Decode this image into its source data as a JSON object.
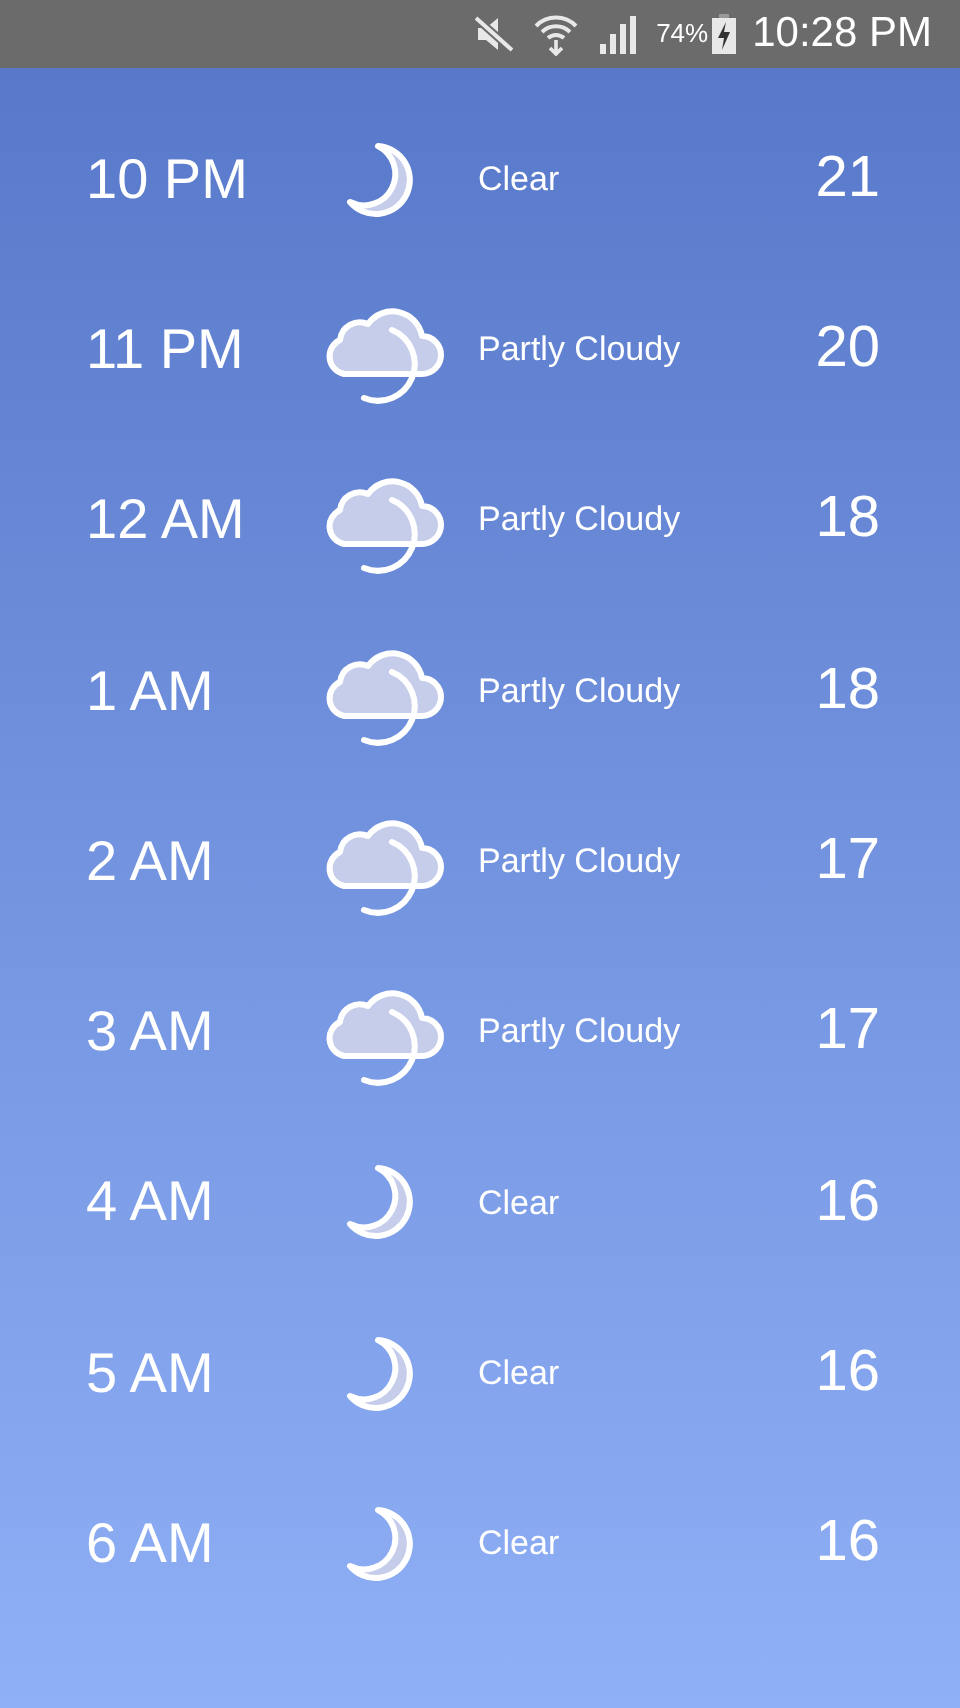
{
  "status_bar": {
    "battery": "74%",
    "time": "10:28 PM"
  },
  "hours": [
    {
      "time": "10 PM",
      "kind": "clear",
      "condition": "Clear",
      "temp": "21"
    },
    {
      "time": "11 PM",
      "kind": "partly-cloudy",
      "condition": "Partly Cloudy",
      "temp": "20"
    },
    {
      "time": "12 AM",
      "kind": "partly-cloudy",
      "condition": "Partly Cloudy",
      "temp": "18"
    },
    {
      "time": "1 AM",
      "kind": "partly-cloudy",
      "condition": "Partly Cloudy",
      "temp": "18"
    },
    {
      "time": "2 AM",
      "kind": "partly-cloudy",
      "condition": "Partly Cloudy",
      "temp": "17"
    },
    {
      "time": "3 AM",
      "kind": "partly-cloudy",
      "condition": "Partly Cloudy",
      "temp": "17"
    },
    {
      "time": "4 AM",
      "kind": "clear",
      "condition": "Clear",
      "temp": "16"
    },
    {
      "time": "5 AM",
      "kind": "clear",
      "condition": "Clear",
      "temp": "16"
    },
    {
      "time": "6 AM",
      "kind": "clear",
      "condition": "Clear",
      "temp": "16"
    }
  ]
}
